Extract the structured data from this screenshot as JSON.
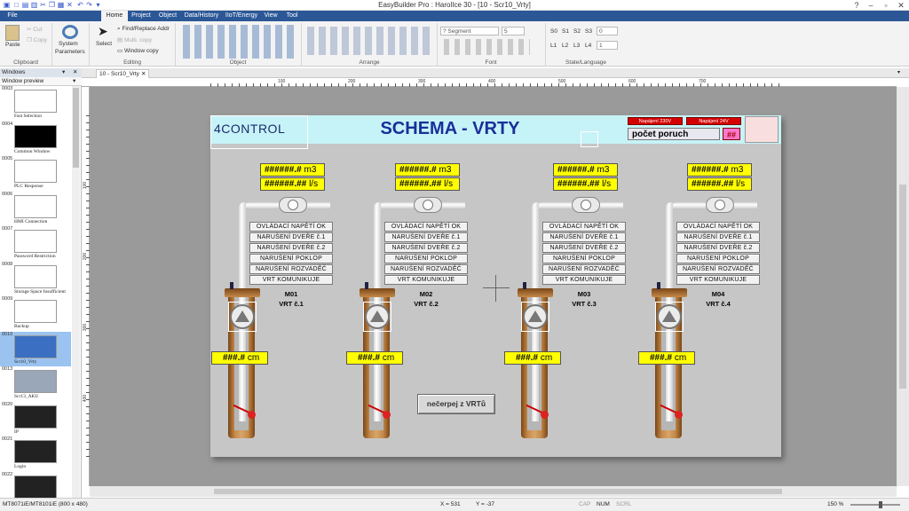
{
  "app": {
    "title": "EasyBuilder Pro : HarolIce 30 - [10 - Scr10_Vrty]",
    "menu_tabs": [
      "File",
      "Home",
      "Project",
      "Object",
      "Data/History",
      "IIoT/Energy",
      "View",
      "Tool"
    ],
    "active_tab": "Home"
  },
  "ribbon": {
    "clipboard": {
      "paste": "Paste",
      "cut": "Cut",
      "copy": "Copy",
      "group": "Clipboard"
    },
    "system": {
      "label1": "System",
      "label2": "Parameters"
    },
    "editing": {
      "select": "Select",
      "find_replace": "Find/Replace Addr",
      "multi_copy": "Multi. copy",
      "window_copy": "Window copy",
      "group": "Editing"
    },
    "object_group": "Object",
    "arrange_group": "Arrange",
    "font": {
      "name": "? Segment",
      "size": "5",
      "group": "Font"
    },
    "state": {
      "s": [
        "S0",
        "S1",
        "S2",
        "S3"
      ],
      "s_value": "0",
      "l": [
        "L1",
        "L2",
        "L3",
        "L4"
      ],
      "l_value": "1",
      "group": "State/Language"
    }
  },
  "windows_panel": {
    "title": "Windows",
    "sub": "Window preview",
    "items": [
      {
        "num": "0003",
        "name": "Fast Selection"
      },
      {
        "num": "0004",
        "name": "Common Window"
      },
      {
        "num": "0005",
        "name": "PLC Response"
      },
      {
        "num": "0006",
        "name": "HMI Connection"
      },
      {
        "num": "0007",
        "name": "Password Restriction"
      },
      {
        "num": "0008",
        "name": "Storage Space Insufficient"
      },
      {
        "num": "0009",
        "name": "Backup"
      },
      {
        "num": "0010",
        "name": "Scr10_Vrty"
      },
      {
        "num": "0013",
        "name": "Scr13_AKU"
      },
      {
        "num": "0020",
        "name": "IP"
      },
      {
        "num": "0021",
        "name": "Login"
      },
      {
        "num": "0022",
        "name": ""
      }
    ]
  },
  "doc_tab": "10 - Scr10_Vrty",
  "ruler": [
    "100",
    "200",
    "300",
    "400",
    "500",
    "600",
    "700"
  ],
  "vruler": [
    "100",
    "200",
    "300",
    "400"
  ],
  "hmi": {
    "logo": "4CONTROL",
    "title": "SCHEMA - VRTY",
    "lamp1": "Napájení 230V",
    "lamp2": "Napájení 24V",
    "poruch_label": "počet poruch",
    "poruch_value": "##",
    "button": "nečerpej z VRTů",
    "flow_value": "######.#",
    "flow_unit": "m3",
    "rate_value": "######.##",
    "rate_unit": "l/s",
    "level_value": "###.#",
    "level_unit": "cm",
    "statuses": [
      "OVLÁDACÍ NAPĚTÍ OK",
      "NARUŠENÍ DVEŘE č.1",
      "NARUŠENÍ DVEŘE č.2",
      "NARUŠENÍ POKLOP",
      "NARUŠENÍ ROZVADĚČ",
      "VRT KOMUNIKUJE"
    ],
    "wells": [
      {
        "motor": "M01",
        "name": "VRT č.1"
      },
      {
        "motor": "M02",
        "name": "VRT č.2"
      },
      {
        "motor": "M03",
        "name": "VRT č.3"
      },
      {
        "motor": "M04",
        "name": "VRT č.4"
      }
    ]
  },
  "statusbar": {
    "model": "MT8071iE/MT8101iE (800 x 480)",
    "x": "X = 531",
    "y": "Y = -37",
    "cap": "CAP",
    "num": "NUM",
    "scrl": "SCRL",
    "zoom": "150 %"
  },
  "colors": {
    "menubar": "#2b5797",
    "header": "#c6f3f7",
    "title": "#1a2f9a",
    "yellow": "#ffff00",
    "red": "#d40000"
  }
}
